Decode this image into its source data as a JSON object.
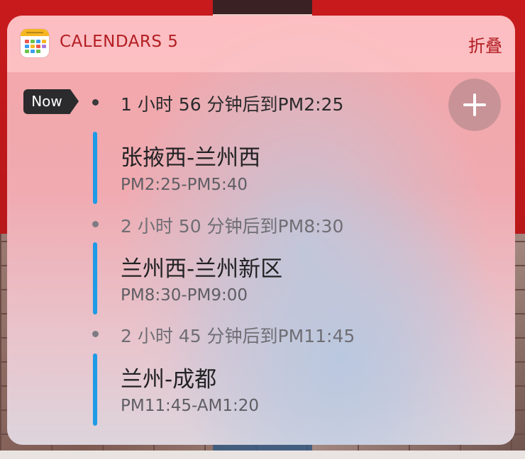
{
  "widget": {
    "app_title": "CALENDARS 5",
    "collapse_label": "折叠",
    "now_label": "Now",
    "add_button_icon": "plus-icon",
    "app_icon": "calendars-app-icon"
  },
  "events": [
    {
      "countdown": "1 小时 56 分钟后到PM2:25",
      "title": "张掖西-兰州西",
      "time": "PM2:25-PM5:40"
    },
    {
      "countdown": "2 小时 50 分钟后到PM8:30",
      "title": "兰州西-兰州新区",
      "time": "PM8:30-PM9:00"
    },
    {
      "countdown": "2 小时 45 分钟后到PM11:45",
      "title": "兰州-成都",
      "time": "PM11:45-AM1:20"
    }
  ],
  "colors": {
    "accent_red": "#b21d22",
    "event_bar": "#1e9be6"
  }
}
